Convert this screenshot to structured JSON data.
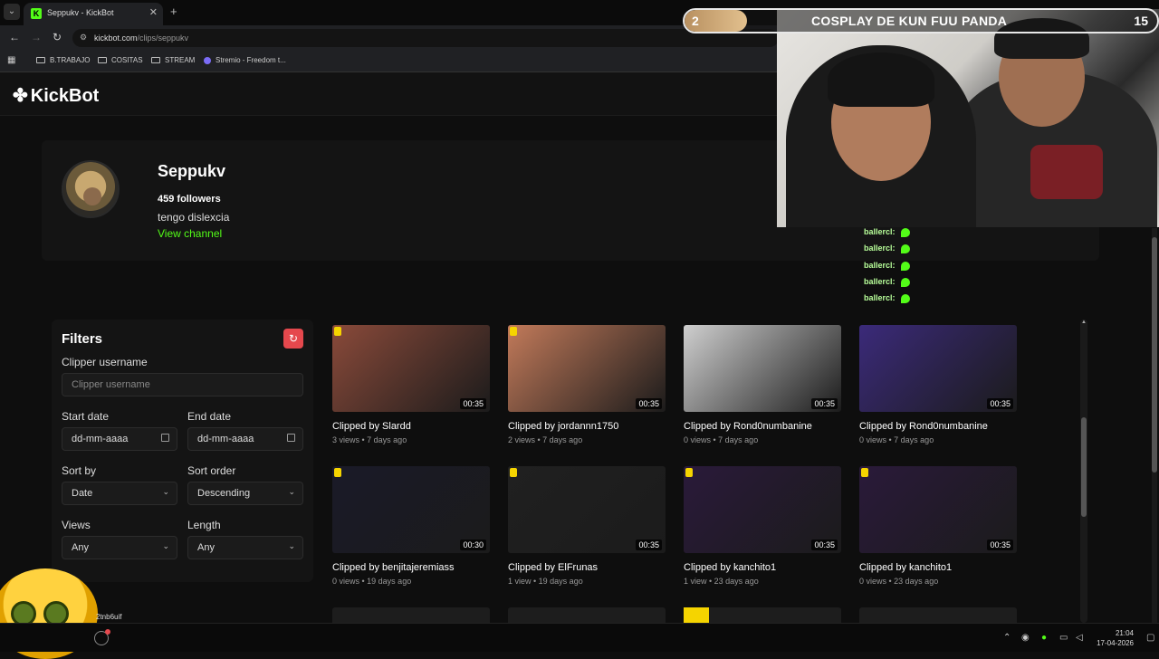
{
  "browser": {
    "tab_title": "Seppukv - KickBot",
    "tab_close": "✕",
    "new_tab": "+",
    "url_host": "kickbot.com",
    "url_path": "/clips/seppukv",
    "bookmarks": [
      "B.TRABAJO",
      "COSITAS",
      "STREAM",
      "Stremio - Freedom t..."
    ]
  },
  "site": {
    "logo": "KickBot",
    "logo_mark": "✤"
  },
  "profile": {
    "name": "Seppukv",
    "followers": "459 followers",
    "bio": "tengo dislexcia",
    "link": "View channel"
  },
  "filters": {
    "title": "Filters",
    "reset_icon": "↻",
    "clipper_label": "Clipper username",
    "clipper_placeholder": "Clipper username",
    "start_label": "Start date",
    "start_value": "dd-mm-aaaa",
    "end_label": "End date",
    "end_value": "dd-mm-aaaa",
    "sortby_label": "Sort by",
    "sortby_value": "Date",
    "order_label": "Sort order",
    "order_value": "Descending",
    "views_label": "Views",
    "views_value": "Any",
    "length_label": "Length",
    "length_value": "Any"
  },
  "clips": [
    {
      "title": "Clipped by Slardd",
      "meta": "3 views • 7 days ago",
      "duration": "00:35",
      "color": "#8a4a3a"
    },
    {
      "title": "Clipped by jordannn1750",
      "meta": "2 views • 7 days ago",
      "duration": "00:35",
      "color": "#c27a5a"
    },
    {
      "title": "Clipped by Rond0numbanine",
      "meta": "0 views • 7 days ago",
      "duration": "00:35",
      "color": "#cfcfcf"
    },
    {
      "title": "Clipped by Rond0numbanine",
      "meta": "0 views • 7 days ago",
      "duration": "00:35",
      "color": "#3b2a7a"
    },
    {
      "title": "Clipped by benjitajeremiass",
      "meta": "0 views • 19 days ago",
      "duration": "00:30",
      "color": "#1a1a28"
    },
    {
      "title": "Clipped by ElFrunas",
      "meta": "1 view • 19 days ago",
      "duration": "00:35",
      "color": "#202020"
    },
    {
      "title": "Clipped by kanchito1",
      "meta": "1 view • 23 days ago",
      "duration": "00:35",
      "color": "#2a1a3a"
    },
    {
      "title": "Clipped by kanchito1",
      "meta": "0 views • 23 days ago",
      "duration": "00:35",
      "color": "#2a1a3a"
    }
  ],
  "overlay": {
    "goal_current": "2",
    "goal_text": "COSPLAY DE KUN FUU PANDA",
    "goal_target": "15",
    "goal_progress": 0.133,
    "chat_user": "ballercl:",
    "mascot_label": "2tnb6uif"
  },
  "taskbar": {
    "time": "21:04",
    "date": "17-04-2026"
  }
}
